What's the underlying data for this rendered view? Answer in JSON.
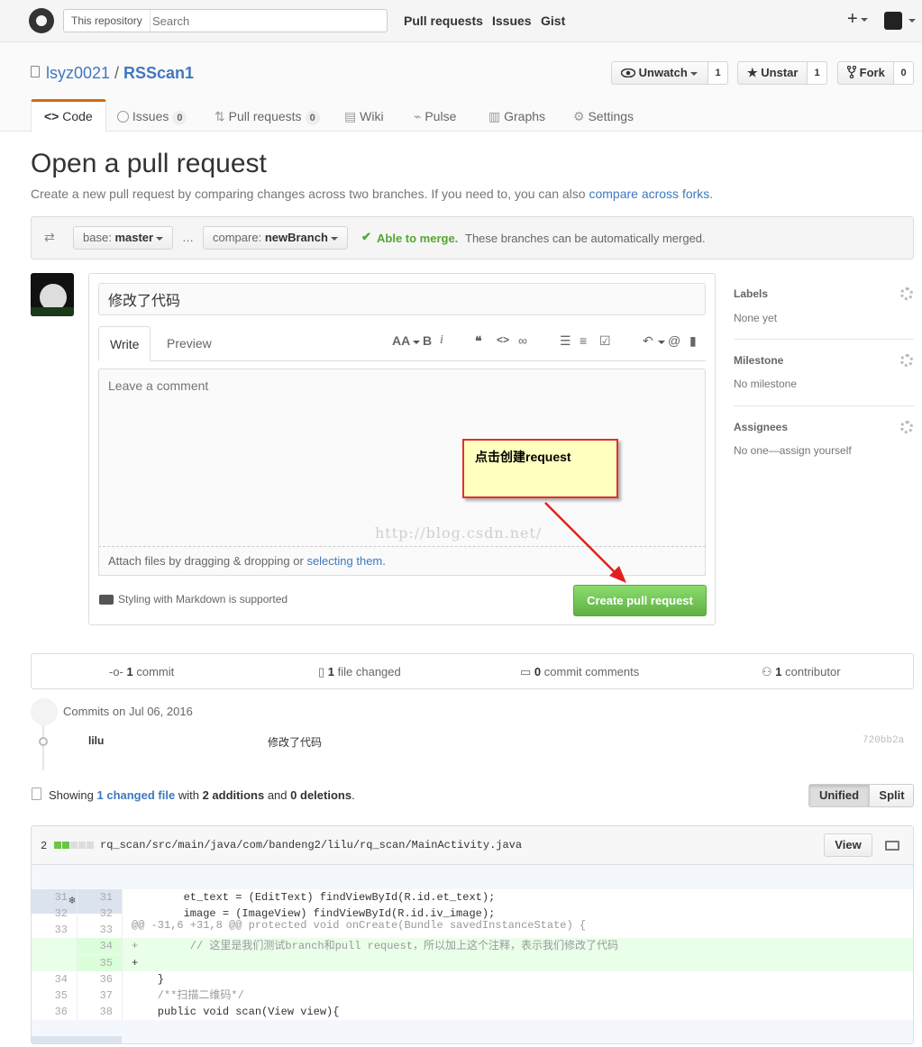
{
  "header": {
    "search_scope": "This repository",
    "search_placeholder": "Search",
    "nav": [
      "Pull requests",
      "Issues",
      "Gist"
    ],
    "plus": "+"
  },
  "repo": {
    "owner": "lsyz0021",
    "separator": "/",
    "name": "RSScan1",
    "watch_label": "Unwatch",
    "watch_count": "1",
    "star_label": "Unstar",
    "star_count": "1",
    "fork_label": "Fork",
    "fork_count": "0",
    "tabs": [
      {
        "label": "Code",
        "icon": "code-icon"
      },
      {
        "label": "Issues",
        "count": "0",
        "icon": "issue-icon"
      },
      {
        "label": "Pull requests",
        "count": "0",
        "icon": "pull-request-icon"
      },
      {
        "label": "Wiki",
        "icon": "book-icon"
      },
      {
        "label": "Pulse",
        "icon": "pulse-icon"
      },
      {
        "label": "Graphs",
        "icon": "graph-icon"
      },
      {
        "label": "Settings",
        "icon": "gear-icon"
      }
    ]
  },
  "pr": {
    "title": "Open a pull request",
    "subtitle": "Create a new pull request by comparing changes across two branches. If you need to, you can also",
    "subtitle_link": "compare across forks",
    "subtitle_end": ".",
    "base_label": "base:",
    "base_branch": "master",
    "ellipsis": "…",
    "compare_label": "compare:",
    "compare_branch": "newBranch",
    "merge_status": "Able to merge.",
    "merge_note": "These branches can be automatically merged."
  },
  "composer": {
    "title_value": "修改了代码",
    "write_tab": "Write",
    "preview_tab": "Preview",
    "body_placeholder": "Leave a comment",
    "attach_text": "Attach files by dragging & dropping or",
    "attach_link": "selecting them",
    "attach_end": ".",
    "markdown_note": "Styling with Markdown is supported",
    "create_button": "Create pull request",
    "toolbar": {
      "aa": "AA",
      "bold": "B",
      "italic": "i"
    }
  },
  "annotation": {
    "callout": "点击创建request",
    "watermark": "http://blog.csdn.net/",
    "arrow_color": "#e02020"
  },
  "sidebar": {
    "labels_title": "Labels",
    "labels_value": "None yet",
    "milestone_title": "Milestone",
    "milestone_value": "No milestone",
    "assignees_title": "Assignees",
    "assignees_value": "No one—assign yourself"
  },
  "summary": {
    "commits_n": "1",
    "commits_label": "commit",
    "files_n": "1",
    "files_label": "file changed",
    "comments_n": "0",
    "comments_label": "commit comments",
    "contrib_n": "1",
    "contrib_label": "contributor"
  },
  "commits": {
    "heading": "Commits on Jul 06, 2016",
    "author": "lilu",
    "message": "修改了代码",
    "sha": "720bb2a"
  },
  "showing": {
    "prefix": "Showing",
    "link": "1 changed file",
    "mid": "with",
    "additions": "2 additions",
    "and": "and",
    "deletions": "0 deletions",
    "end": ".",
    "unified": "Unified",
    "split": "Split"
  },
  "diff": {
    "count": "2",
    "path": "rq_scan/src/main/java/com/bandeng2/lilu/rq_scan/MainActivity.java",
    "view_button": "View",
    "hunk": "@@ -31,6 +31,8 @@ protected void onCreate(Bundle savedInstanceState) {",
    "lines": [
      {
        "old": "31",
        "new": "31",
        "code": "        et_text = (EditText) findViewById(R.id.et_text);"
      },
      {
        "old": "32",
        "new": "32",
        "code": "        image = (ImageView) findViewById(R.id.iv_image);"
      },
      {
        "old": "33",
        "new": "33",
        "code": ""
      },
      {
        "old": "",
        "new": "34",
        "code": "+        // 这里是我们测试branch和pull request，所以加上这个注释，表示我们修改了代码"
      },
      {
        "old": "",
        "new": "35",
        "code": "+"
      },
      {
        "old": "34",
        "new": "36",
        "code": "    }"
      },
      {
        "old": "35",
        "new": "37",
        "code": "    /**扫描二维码*/"
      },
      {
        "old": "36",
        "new": "38",
        "code": "    public void scan(View view){"
      }
    ]
  }
}
